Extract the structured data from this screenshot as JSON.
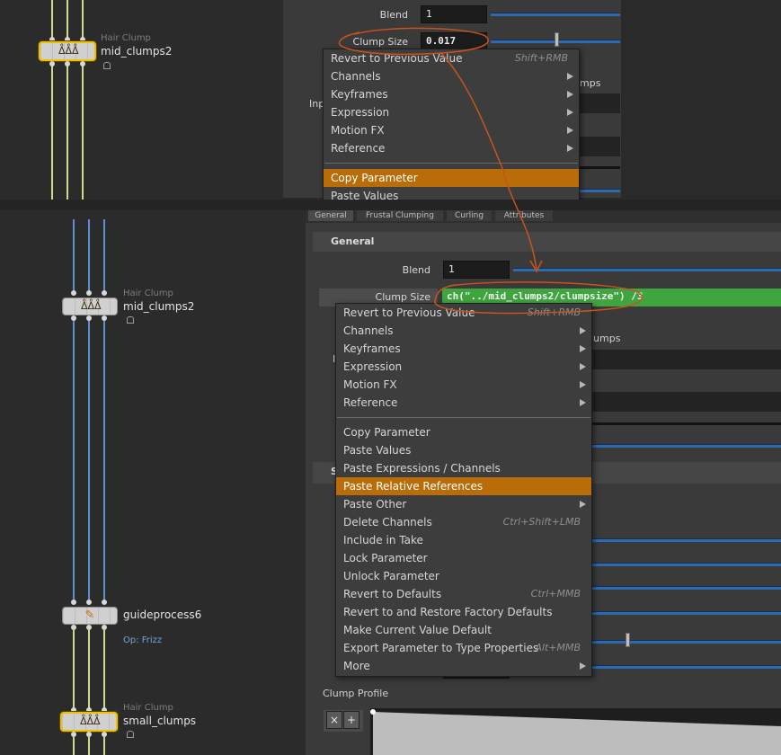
{
  "nodes": {
    "top_mid": {
      "type": "Hair Clump",
      "name": "mid_clumps2"
    },
    "mid_mid": {
      "type": "Hair Clump",
      "name": "mid_clumps2"
    },
    "guideprocess": {
      "name": "guideprocess6",
      "op": "Op: Frizz"
    },
    "small": {
      "type": "Hair Clump",
      "name": "small_clumps"
    }
  },
  "top_panel": {
    "blend_label": "Blend",
    "blend_value": "1",
    "clump_size_label": "Clump Size",
    "clump_size_value": "0.017",
    "behind_text_1": "mps",
    "behind_text_2": "Inp"
  },
  "bottom_panel": {
    "tabs": [
      "General",
      "Frustal Clumping",
      "Curling",
      "Attributes"
    ],
    "section_general": "General",
    "blend_label": "Blend",
    "blend_value": "1",
    "clump_size_label": "Clump Size",
    "clump_size_expr": "ch(\"../mid_clumps2/clumpsize\") /3",
    "behind_text_1": "lumps",
    "behind_text_2": "I",
    "section_s": "S",
    "clump_profile_label": "Clump Profile",
    "remove_btn": "×",
    "add_btn": "+"
  },
  "menu_top": {
    "items": [
      {
        "label": "Revert to Previous Value",
        "shortcut": "Shift+RMB"
      },
      {
        "label": "Channels",
        "submenu": true
      },
      {
        "label": "Keyframes",
        "submenu": true
      },
      {
        "label": "Expression",
        "submenu": true
      },
      {
        "label": "Motion FX",
        "submenu": true
      },
      {
        "label": "Reference",
        "submenu": true
      },
      {
        "label": "Copy Parameter",
        "highlighted": true
      },
      {
        "label": "Paste Values"
      }
    ]
  },
  "menu_bottom": {
    "items": [
      {
        "label": "Revert to Previous Value",
        "shortcut": "Shift+RMB"
      },
      {
        "label": "Channels",
        "submenu": true
      },
      {
        "label": "Keyframes",
        "submenu": true
      },
      {
        "label": "Expression",
        "submenu": true
      },
      {
        "label": "Motion FX",
        "submenu": true
      },
      {
        "label": "Reference",
        "submenu": true
      },
      {
        "label": "Copy Parameter"
      },
      {
        "label": "Paste Values"
      },
      {
        "label": "Paste Expressions / Channels"
      },
      {
        "label": "Paste Relative References",
        "highlighted": true
      },
      {
        "label": "Paste Other",
        "submenu": true
      },
      {
        "label": "Delete Channels",
        "shortcut": "Ctrl+Shift+LMB"
      },
      {
        "label": "Include in Take"
      },
      {
        "label": "Lock Parameter"
      },
      {
        "label": "Unlock Parameter"
      },
      {
        "label": "Revert to Defaults",
        "shortcut": "Ctrl+MMB"
      },
      {
        "label": "Revert to and Restore Factory Defaults"
      },
      {
        "label": "Make Current Value Default"
      },
      {
        "label": "Export Parameter to Type Properties",
        "shortcut": "Alt+MMB"
      },
      {
        "label": "More",
        "submenu": true
      }
    ]
  },
  "colors": {
    "highlight": "#b86d08",
    "annotation": "#c8541c",
    "expression_bg": "#3fa53f",
    "slider": "#2e6ab2",
    "selected_node": "#f0c000"
  }
}
